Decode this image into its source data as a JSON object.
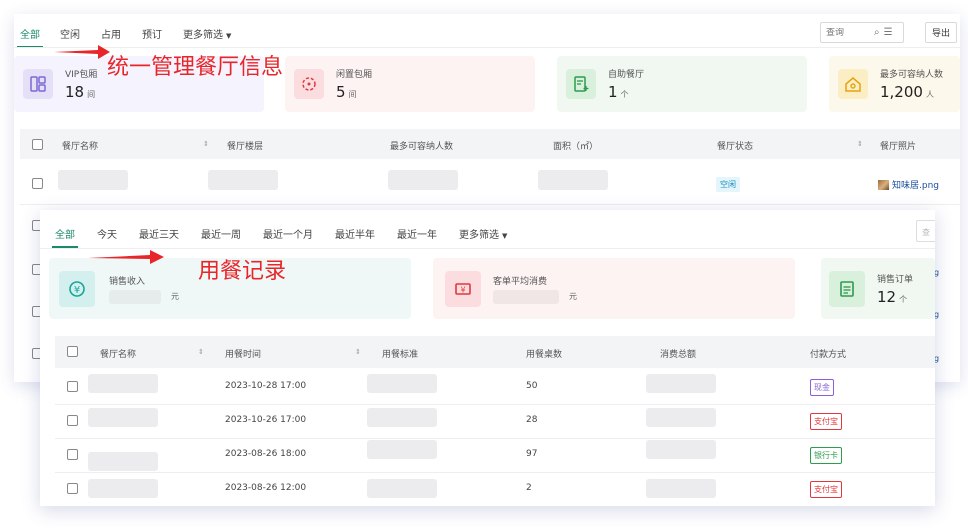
{
  "restaurant_panel": {
    "tabs": [
      {
        "label": "全部",
        "active": true
      },
      {
        "label": "空闲",
        "active": false
      },
      {
        "label": "占用",
        "active": false
      },
      {
        "label": "预订",
        "active": false
      },
      {
        "label": "更多筛选",
        "active": false
      }
    ],
    "search_placeholder": "查询",
    "export_label": "导出",
    "stats": [
      {
        "label": "VIP包厢",
        "value": "18",
        "unit": "间",
        "icon": "rooms-icon"
      },
      {
        "label": "闲置包厢",
        "value": "5",
        "unit": "间",
        "icon": "idle-room-icon"
      },
      {
        "label": "自助餐厅",
        "value": "1",
        "unit": "个",
        "icon": "buffet-icon"
      },
      {
        "label": "最多可容纳人数",
        "value": "1,200",
        "unit": "人",
        "icon": "capacity-house-icon"
      }
    ],
    "columns": [
      "餐厅名称",
      "餐厅楼层",
      "最多可容纳人数",
      "面积（㎡）",
      "餐厅状态",
      "餐厅照片"
    ],
    "row": {
      "status": "空闲",
      "photo": "知味居.png"
    },
    "side_fragments": [
      "g",
      "g",
      "g"
    ]
  },
  "dining_panel": {
    "tabs": [
      {
        "label": "全部",
        "active": true
      },
      {
        "label": "今天",
        "active": false
      },
      {
        "label": "最近三天",
        "active": false
      },
      {
        "label": "最近一周",
        "active": false
      },
      {
        "label": "最近一个月",
        "active": false
      },
      {
        "label": "最近半年",
        "active": false
      },
      {
        "label": "最近一年",
        "active": false
      },
      {
        "label": "更多筛选",
        "active": false
      }
    ],
    "search_fragment": "查",
    "stats": [
      {
        "label": "销售收入",
        "value": "",
        "unit": "元",
        "icon": "revenue-icon"
      },
      {
        "label": "客单平均消费",
        "value": "",
        "unit": "元",
        "icon": "ticket-icon"
      },
      {
        "label": "销售订单",
        "value": "12",
        "unit": "个",
        "icon": "order-icon"
      }
    ],
    "columns": [
      "餐厅名称",
      "用餐时间",
      "用餐标准",
      "用餐桌数",
      "消费总额",
      "付款方式"
    ],
    "rows": [
      {
        "time": "2023-10-28 17:00",
        "tables": "50",
        "payment": "现金"
      },
      {
        "time": "2023-10-26 17:00",
        "tables": "28",
        "payment": "支付宝"
      },
      {
        "time": "2023-08-26 18:00",
        "tables": "97",
        "payment": "银行卡"
      },
      {
        "time": "2023-08-26 12:00",
        "tables": "2",
        "payment": "支付宝"
      }
    ]
  },
  "annotations": {
    "restaurant_info": "统一管理餐厅信息",
    "dining_records": "用餐记录"
  },
  "colors": {
    "accent": "#1a8a6b",
    "annotation": "#e8262a",
    "pay_cash": "#8a5fd9",
    "pay_alipay": "#e0383e",
    "pay_bank": "#2e9b4e"
  }
}
